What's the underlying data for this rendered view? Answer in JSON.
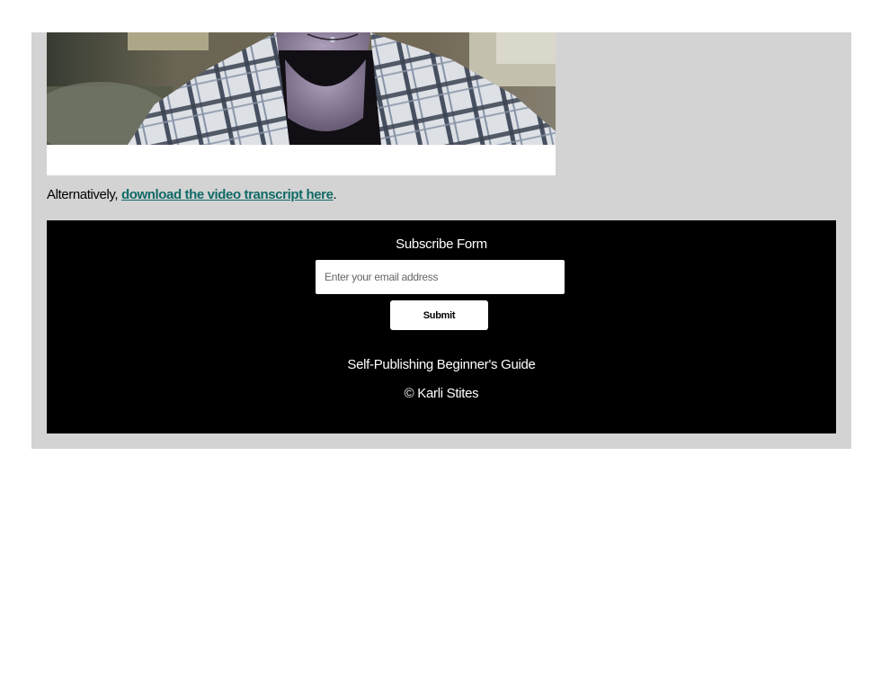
{
  "content": {
    "transcript_prefix": "Alternatively, ",
    "transcript_link": "download the video transcript here",
    "transcript_suffix": "."
  },
  "subscribe": {
    "title": "Subscribe Form",
    "email_placeholder": "Enter your email address",
    "email_value": "",
    "submit_label": "Submit"
  },
  "footer": {
    "site_name": "Self-Publishing Beginner's Guide",
    "copyright": "© Karli Stites"
  },
  "colors": {
    "page_background": "#ffffff",
    "content_background": "#d3d3d3",
    "footer_background": "#000000",
    "link": "#0f6a66"
  }
}
